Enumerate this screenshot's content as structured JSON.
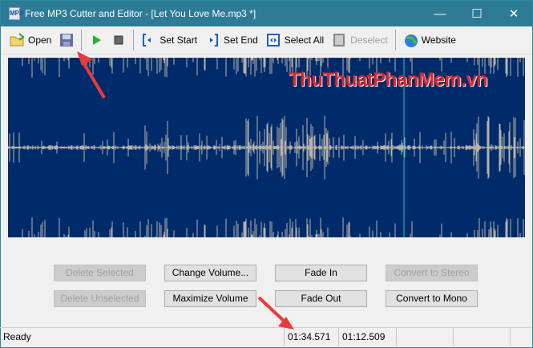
{
  "title": "Free MP3 Cutter and Editor - [Let You Love Me.mp3 *]",
  "app_icon_text": "MP3",
  "window_controls": {
    "minimize": "—",
    "maximize": "☐",
    "close": "✕"
  },
  "toolbar": {
    "open": "Open",
    "set_start": "Set Start",
    "set_end": "Set End",
    "select_all": "Select All",
    "deselect": "Deselect",
    "website": "Website"
  },
  "watermark": "ThuThuatPhanMem.vn",
  "buttons": {
    "delete_selected": "Delete Selected",
    "change_volume": "Change Volume...",
    "fade_in": "Fade In",
    "convert_stereo": "Convert to Stereo",
    "delete_unselected": "Delete Unselected",
    "maximize_volume": "Maximize Volume",
    "fade_out": "Fade Out",
    "convert_mono": "Convert to Mono"
  },
  "status": {
    "text": "Ready",
    "position": "01:34.571",
    "length": "01:12.509"
  },
  "colors": {
    "wave_bg": "#002b6b",
    "wave": "#b8b3a8",
    "cursor": "#19c8c8",
    "titlebar": "#2e7b96"
  }
}
